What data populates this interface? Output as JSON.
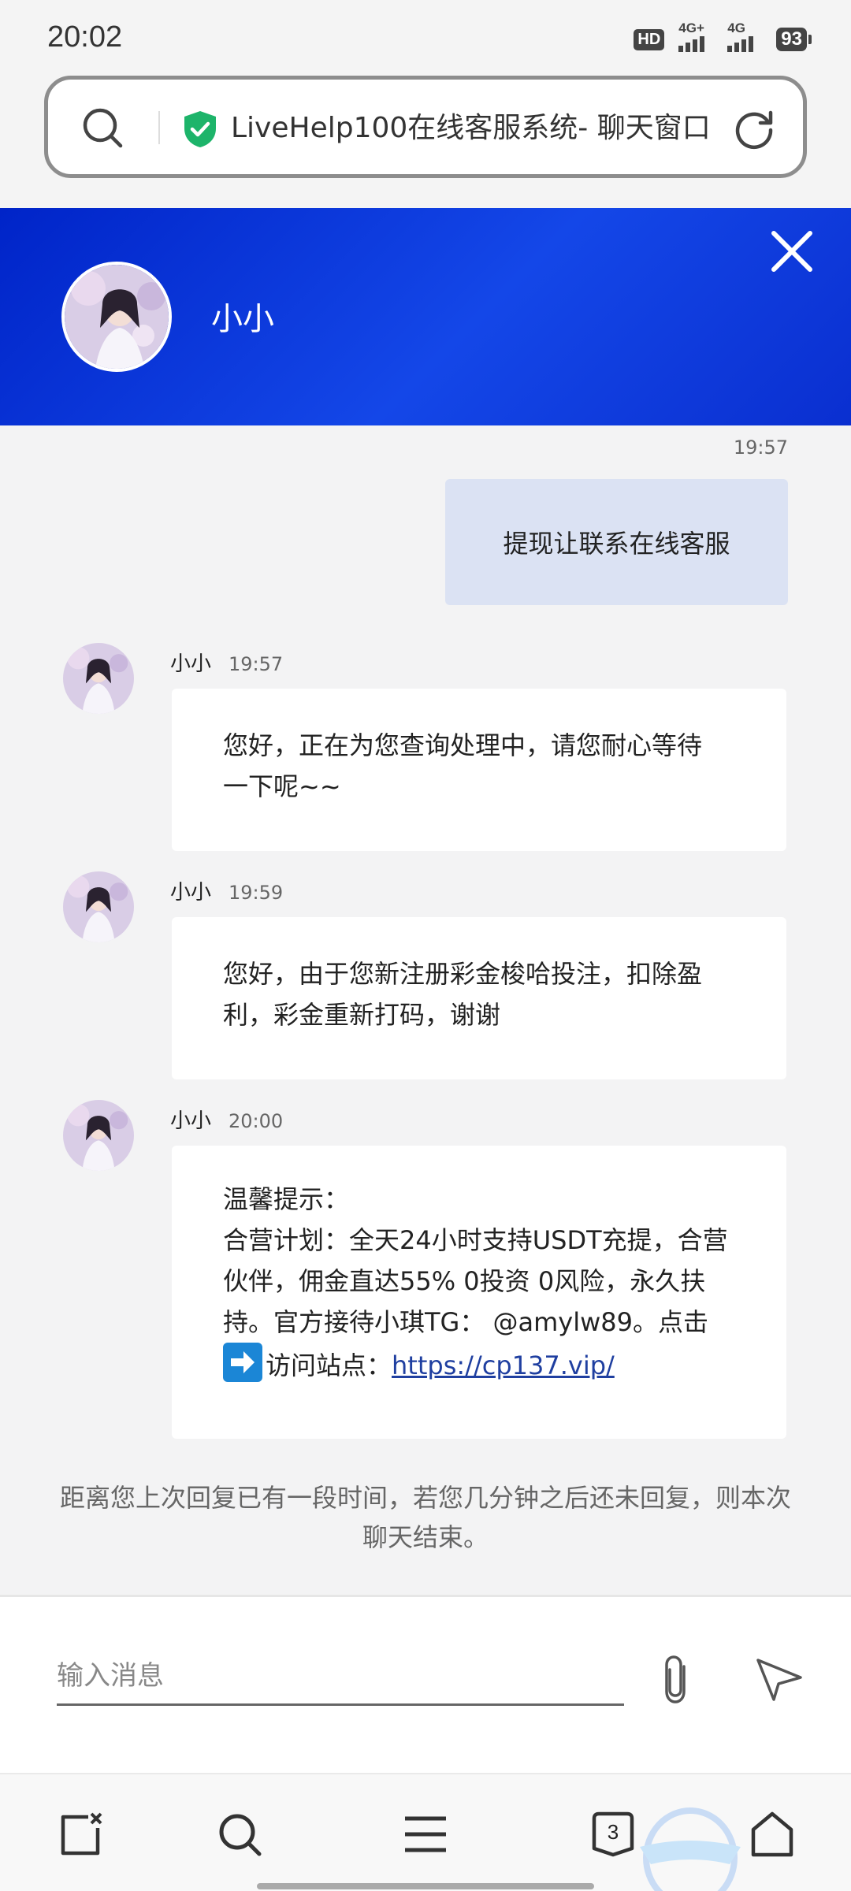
{
  "status_bar": {
    "time": "20:02",
    "hd": "HD",
    "signal1": "4G+",
    "signal2": "4G",
    "battery": "93"
  },
  "url_bar": {
    "title": "LiveHelp100在线客服系统- 聊天窗口"
  },
  "chat_header": {
    "agent_name": "小小"
  },
  "messages": {
    "user_time": "19:57",
    "user_text": "提现让联系在线客服",
    "agent_msgs": [
      {
        "name": "小小",
        "time": "19:57",
        "lines": [
          "您好，正在为您查询处理中，请您耐心等待",
          "一下呢~~"
        ]
      },
      {
        "name": "小小",
        "time": "19:59",
        "lines": [
          "您好，由于您新注册彩金梭哈投注，扣除盈",
          "利，彩金重新打码，谢谢"
        ]
      },
      {
        "name": "小小",
        "time": "20:00",
        "lines": [
          "温馨提示：",
          "合营计划：全天24小时支持USDT充提，合营",
          "伙伴，佣金直达55% 0投资 0风险，永久扶",
          "持。官方接待小琪TG： @amylw89。点击"
        ],
        "visit_label": "访问站点：",
        "link": "https://cp137.vip/"
      }
    ],
    "notice": "距离您上次回复已有一段时间，若您几分钟之后还未回复，则本次聊天结束。"
  },
  "input": {
    "placeholder": "输入消息"
  },
  "bottom_nav": {
    "tab_count": "3"
  },
  "colors": {
    "header_blue": "#0a2fd8",
    "user_bubble": "#dbe2f3",
    "link": "#1f3fa0",
    "shield_green": "#1db46a"
  }
}
